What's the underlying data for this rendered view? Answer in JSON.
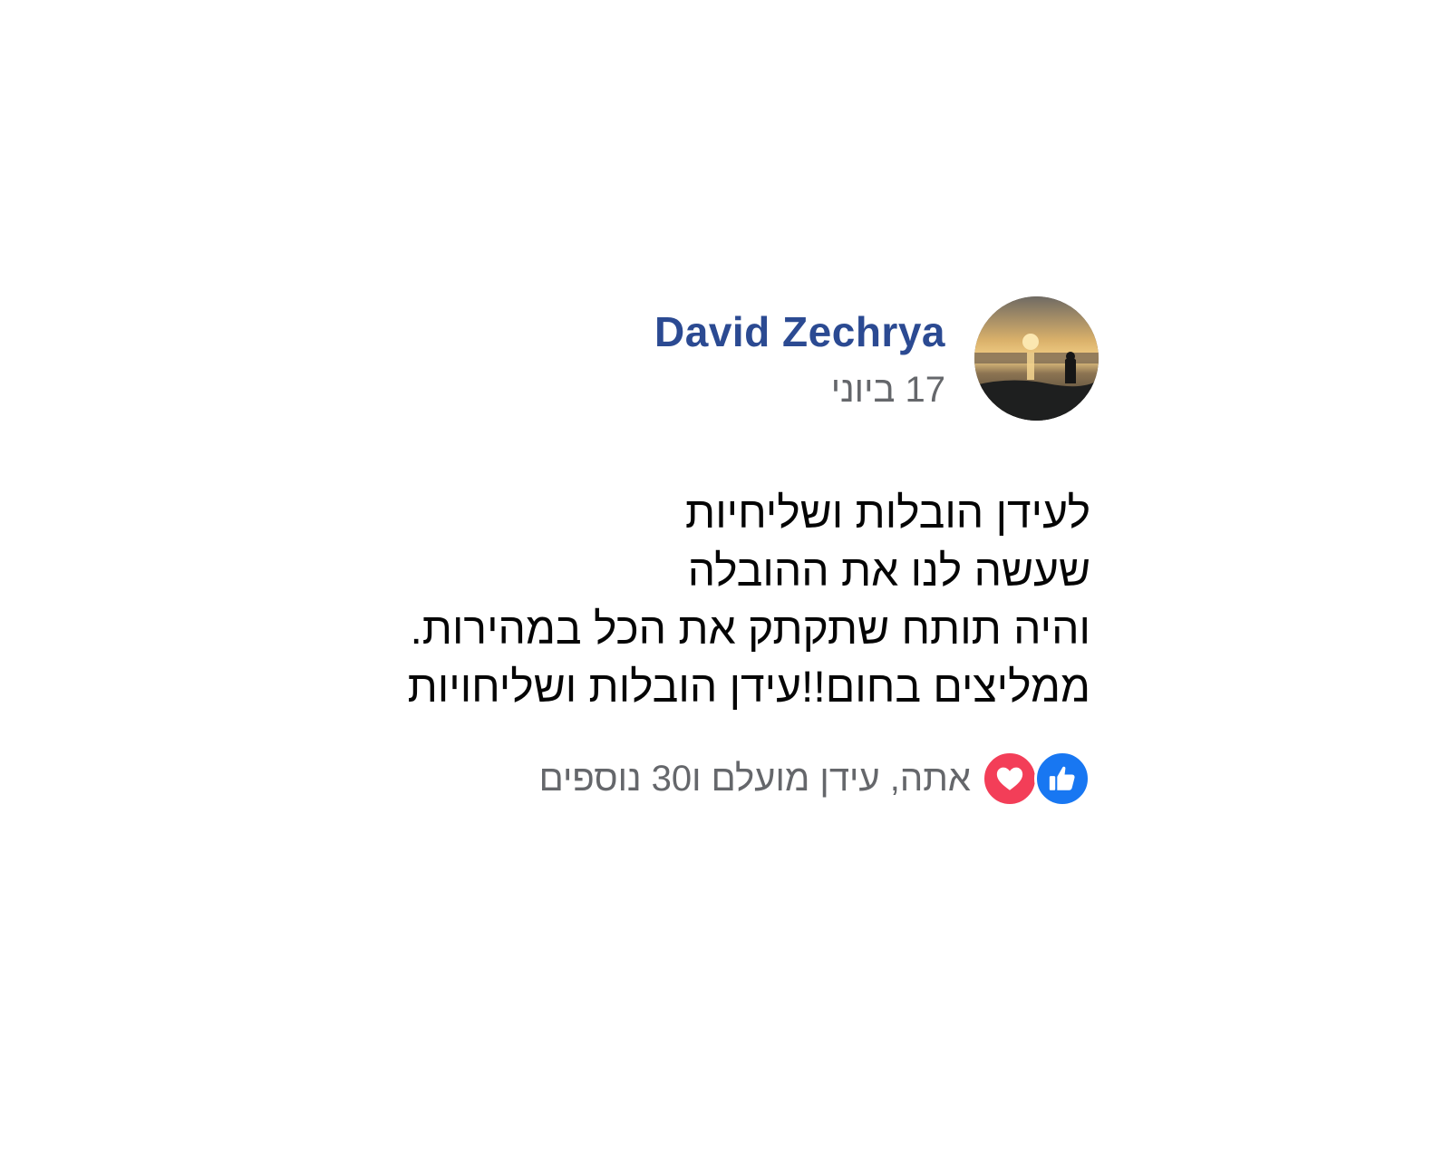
{
  "post": {
    "author_name": "David Zechrya",
    "date": "17 ביוני",
    "body_lines": [
      "לעידן הובלות ושליחיות",
      "שעשה לנו את ההובלה",
      "והיה תותח שתקתק את הכל במהירות.",
      "ממליצים בחום!!עידן הובלות ושליחויות"
    ],
    "reactions": {
      "icons": [
        "thumbs-up-icon",
        "heart-icon"
      ],
      "summary": "אתה, עידן מועלם ו30 נוספים"
    }
  },
  "colors": {
    "author_name": "#2b4a92",
    "secondary_text": "#65676b",
    "body_text": "#050505",
    "like_blue": "#1877f2",
    "love_red": "#f33e58"
  }
}
